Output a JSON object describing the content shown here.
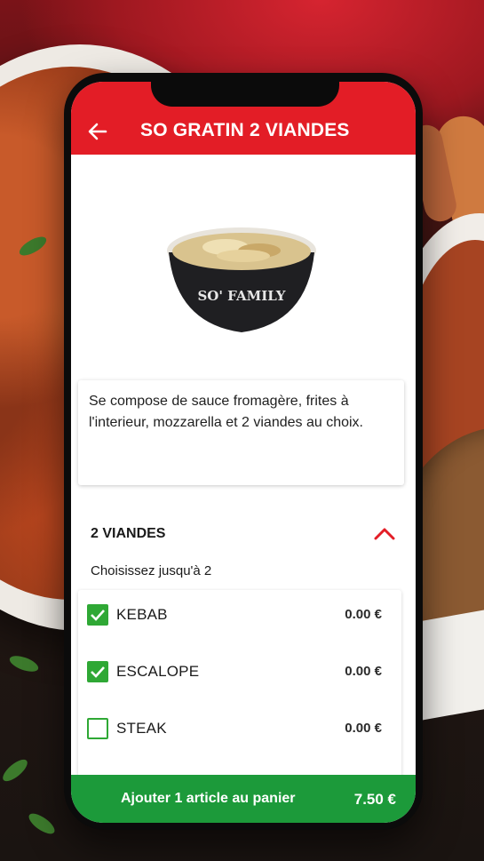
{
  "header": {
    "title": "SO GRATIN 2 VIANDES",
    "back_icon": "arrow-left-icon"
  },
  "product": {
    "image_icon": "gratin-bowl-image",
    "bowl_brand": "SO' FAMILY",
    "description": "Se compose de sauce fromagère, frites à l'interieur, mozzarella et 2 viandes au choix."
  },
  "options_group": {
    "title": "2 VIANDES",
    "subtitle": "Choisissez jusqu'à 2",
    "expanded": true,
    "items": [
      {
        "label": "KEBAB",
        "price": "0.00 €",
        "checked": true
      },
      {
        "label": "ESCALOPE",
        "price": "0.00 €",
        "checked": true
      },
      {
        "label": "STEAK",
        "price": "0.00 €",
        "checked": false
      }
    ]
  },
  "cart": {
    "label": "Ajouter 1 article au panier",
    "total": "7.50 €"
  },
  "colors": {
    "header_red": "#e31d26",
    "checkbox_green": "#2fa835",
    "cart_green": "#1c9a3a"
  }
}
